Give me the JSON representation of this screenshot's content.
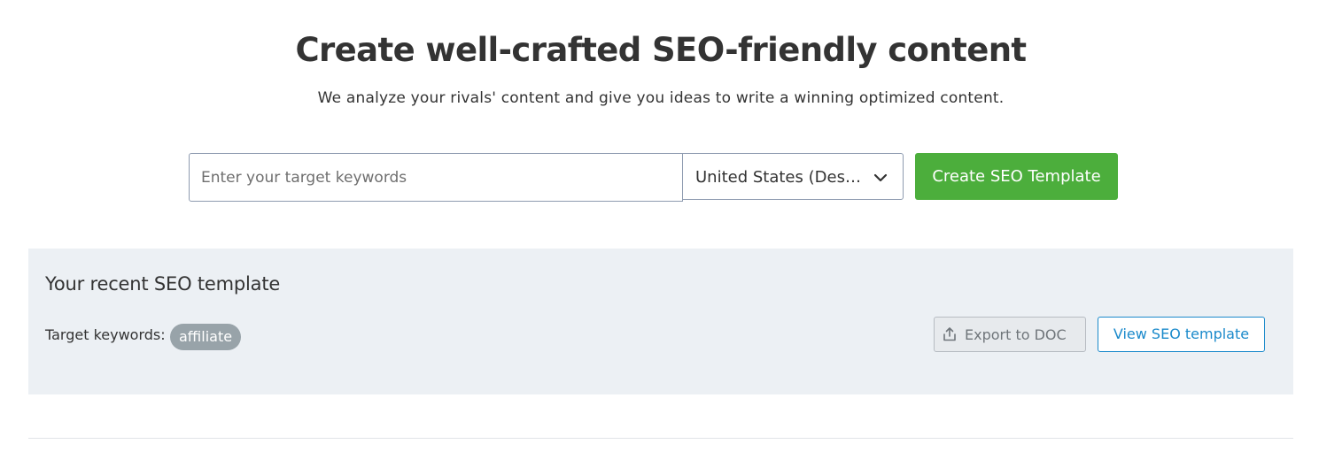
{
  "hero": {
    "title": "Create well-crafted SEO-friendly content",
    "subtitle": "We analyze your rivals' content and give you ideas to write a winning optimized content."
  },
  "search": {
    "keyword_placeholder": "Enter your target keywords",
    "keyword_value": "",
    "database_selected": "United States (Desktop)",
    "database_chevron_icon": "chevron-down-icon",
    "submit_label": "Create SEO Template"
  },
  "recent": {
    "title": "Your recent SEO template",
    "target_keywords_label": "Target keywords:",
    "keywords": [
      "affiliate"
    ],
    "export_label": "Export to DOC",
    "export_icon": "upload-icon",
    "view_label": "View SEO template"
  },
  "colors": {
    "primary_green": "#4cae3c",
    "link_blue": "#1b8acb",
    "panel_bg": "#ecf0f4",
    "tag_bg": "#98a3a9",
    "text": "#333333"
  }
}
